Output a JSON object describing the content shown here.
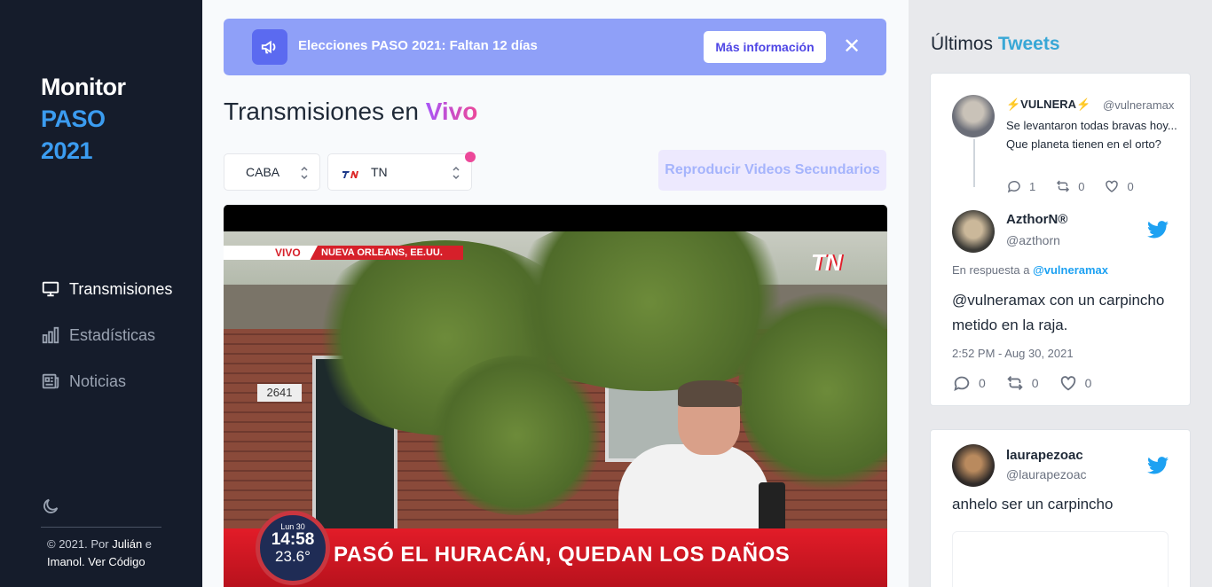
{
  "sidebar": {
    "brand_line1": "Monitor",
    "brand_line2": "PASO",
    "brand_line3": "2021",
    "nav": [
      {
        "label": "Transmisiones",
        "icon": "monitor-icon",
        "active": true
      },
      {
        "label": "Estadísticas",
        "icon": "bar-chart-icon",
        "active": false
      },
      {
        "label": "Noticias",
        "icon": "newspaper-icon",
        "active": false
      }
    ],
    "theme_icon": "moon-icon",
    "footer_prefix": "© 2021. Por",
    "footer_author1": "Julián",
    "footer_and": "e",
    "footer_author2": "Imanol.",
    "footer_link": "Ver Código"
  },
  "banner": {
    "icon": "megaphone-icon",
    "text": "Elecciones PASO 2021: Faltan 12 días",
    "button": "Más información",
    "close": "✕"
  },
  "main": {
    "title_prefix": "Transmisiones en",
    "title_highlight": "Vivo",
    "region_select": "CABA",
    "channel_select": "TN",
    "secondary_button": "Reproducir Videos Secundarios"
  },
  "video": {
    "live_label": "VIVO",
    "location": "NUEVA ORLEANS, EE.UU.",
    "channel_logo": "TN",
    "address": "2641",
    "clock_day": "Lun 30",
    "clock_time": "14:58",
    "clock_temp": "23.6°",
    "headline": "PASÓ EL HURACÁN, QUEDAN LOS DAÑOS"
  },
  "tweets_panel": {
    "title_prefix": "Últimos",
    "title_highlight": "Tweets",
    "colors": {
      "accent": "#38a7d6",
      "twitter": "#1da1f2"
    }
  },
  "tweet1": {
    "parent": {
      "name": "⚡VULNERA⚡",
      "handle": "@vulneramax",
      "text": "Se levantaron todas bravas hoy... Que planeta tienen en el orto?",
      "replies": "1",
      "retweets": "0",
      "likes": "0"
    },
    "reply": {
      "name": "AzthorN®",
      "handle": "@azthorn",
      "reply_prefix": "En respuesta a",
      "reply_to": "@vulneramax",
      "text": "@vulneramax con un carpincho metido en la raja.",
      "time": "2:52 PM - Aug 30, 2021",
      "replies": "0",
      "retweets": "0",
      "likes": "0"
    }
  },
  "tweet2": {
    "name": "laurapezoac",
    "handle": "@laurapezoac",
    "text": "anhelo ser un carpincho"
  }
}
